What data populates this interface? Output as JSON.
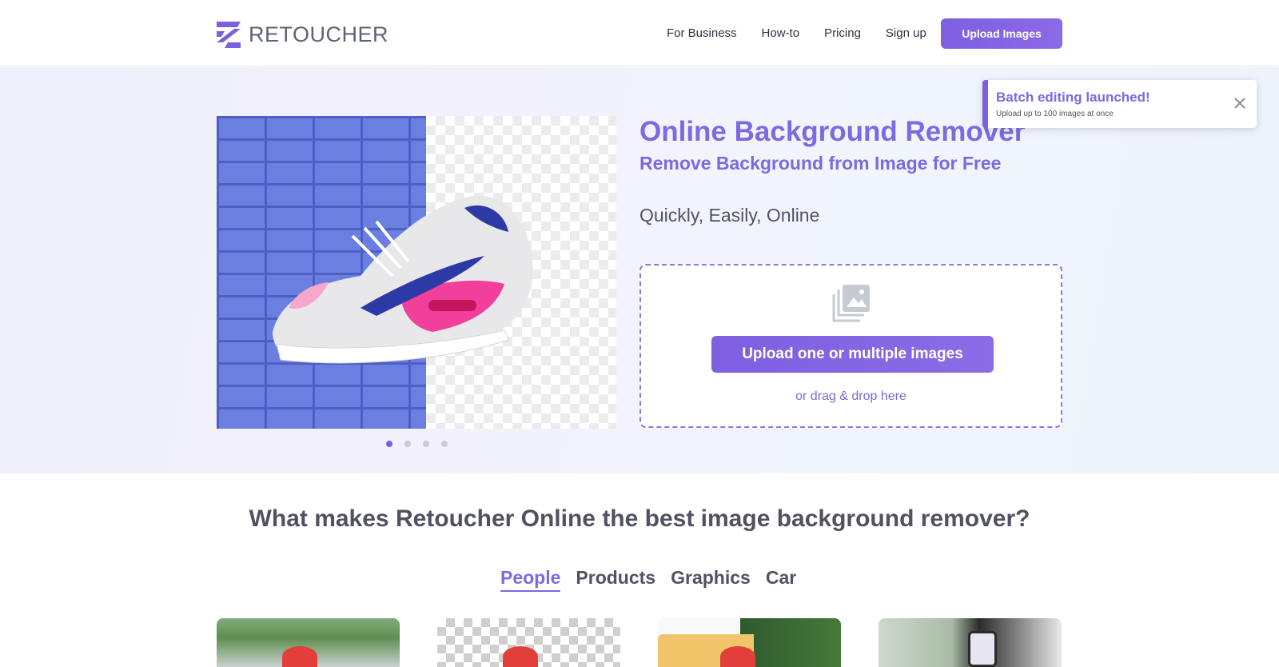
{
  "header": {
    "logo_text": "RETOUCHER",
    "nav": [
      "For Business",
      "How-to",
      "Pricing",
      "Sign up"
    ],
    "upload_button": "Upload Images"
  },
  "hero": {
    "title": "Online Background Remover",
    "subtitle": "Remove Background from Image for Free",
    "tagline": "Quickly, Easily, Online",
    "upload_button": "Upload one or multiple images",
    "drag_text": "or drag & drop here",
    "carousel": {
      "count": 4,
      "active": 1
    }
  },
  "toast": {
    "title": "Batch editing launched!",
    "body": "Upload up to 100 images at once"
  },
  "features": {
    "title": "What makes Retoucher Online the best image background remover?",
    "tabs": [
      "People",
      "Products",
      "Graphics",
      "Car"
    ],
    "active_tab": "People"
  },
  "colors": {
    "accent": "#7b6ae0",
    "button": "#7d5fe0"
  }
}
